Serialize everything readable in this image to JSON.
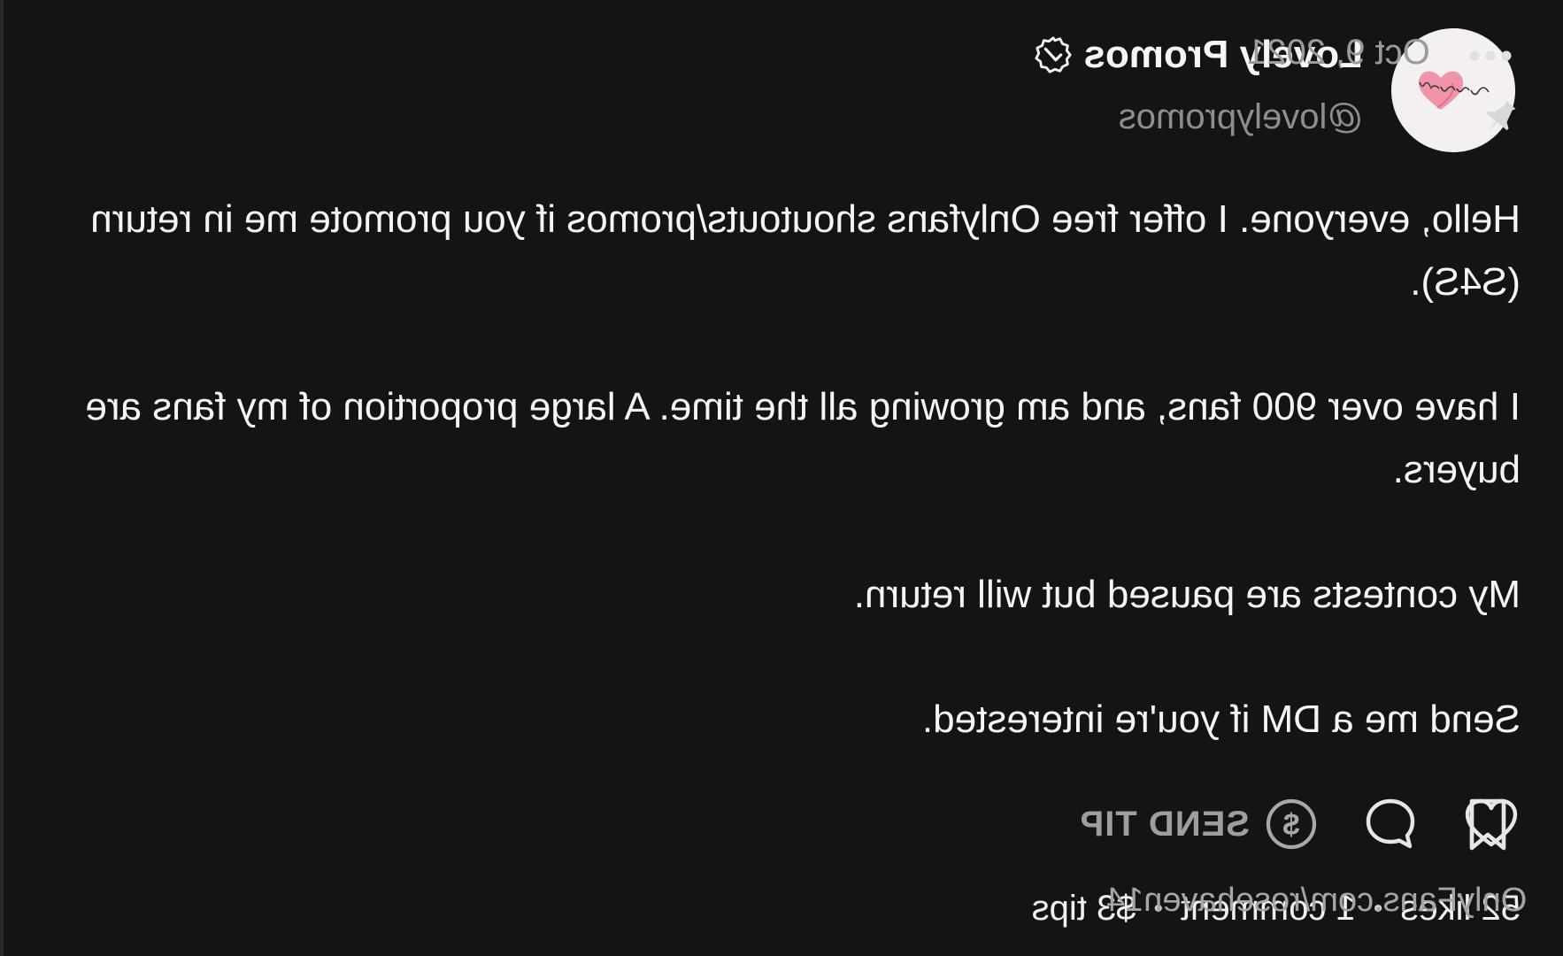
{
  "post": {
    "author": {
      "display_name": "Lovely Promos",
      "handle": "@lovelypromos",
      "avatar_text": "Lovely Promos"
    },
    "date": "Oct 9, 2021",
    "body": [
      "Hello, everyone. I offer free Onlyfans shoutouts/promos if you promote me in return (S4S).",
      "I have over 900 fans, and am growing all the time. A large proportion of my fans are buyers.",
      "My contests are paused but will return.",
      "Send me a DM if you're interested."
    ],
    "actions": {
      "send_tip_label": "SEND TIP"
    },
    "stats": {
      "likes": "52 likes",
      "comments": "1 comment",
      "tips": "$3 tips"
    },
    "watermark": "OnlyFans.com/rosehaven14",
    "icons": {
      "more": "more-dots-icon",
      "pin": "pin-icon",
      "verified": "verified-badge-icon",
      "like": "heart-icon",
      "comment": "comment-bubble-icon",
      "tip": "dollar-circle-icon",
      "bookmark": "bookmark-icon"
    },
    "colors": {
      "background": "#141414",
      "text": "#f5f5f5",
      "muted": "#8e8e8e",
      "icon": "#e6e6e6",
      "avatar_heart": "#f08aa2"
    },
    "mirrored": true
  }
}
